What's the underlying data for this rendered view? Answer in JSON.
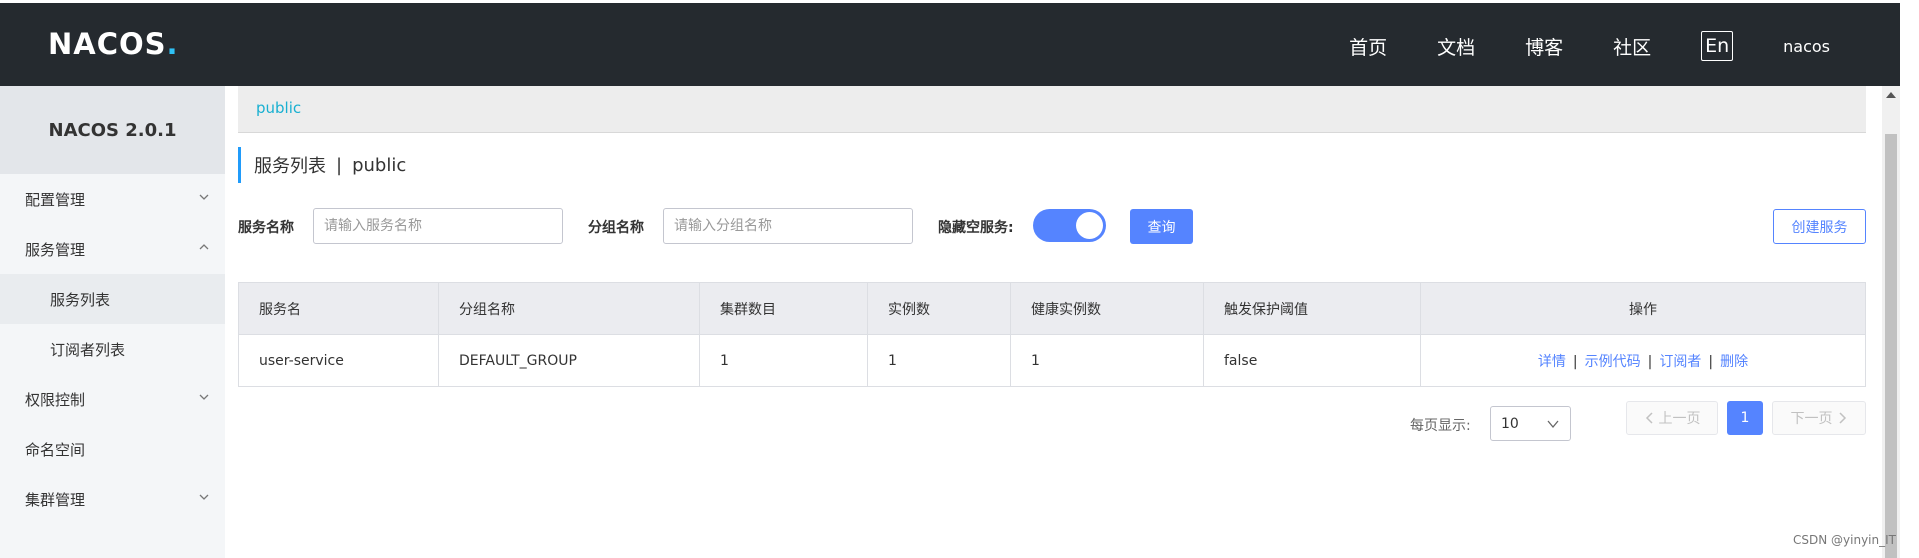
{
  "header": {
    "logo_text": "NACOS",
    "logo_dot": ".",
    "nav": [
      "首页",
      "文档",
      "博客",
      "社区"
    ],
    "lang": "En",
    "user": "nacos"
  },
  "sidebar": {
    "title": "NACOS 2.0.1",
    "items": [
      {
        "label": "配置管理"
      },
      {
        "label": "服务管理"
      },
      {
        "label": "服务列表"
      },
      {
        "label": "订阅者列表"
      },
      {
        "label": "权限控制"
      },
      {
        "label": "命名空间"
      },
      {
        "label": "集群管理"
      }
    ]
  },
  "breadcrumb": {
    "namespace": "public"
  },
  "page": {
    "title": "服务列表",
    "separator": "|",
    "namespace": "public"
  },
  "filters": {
    "service_name_label": "服务名称",
    "service_name_placeholder": "请输入服务名称",
    "group_name_label": "分组名称",
    "group_name_placeholder": "请输入分组名称",
    "hide_empty_label": "隐藏空服务:",
    "hide_empty_on": true,
    "query_label": "查询",
    "create_label": "创建服务"
  },
  "table": {
    "headers": [
      "服务名",
      "分组名称",
      "集群数目",
      "实例数",
      "健康实例数",
      "触发保护阈值",
      "操作"
    ],
    "rows": [
      [
        "user-service",
        "DEFAULT_GROUP",
        "1",
        "1",
        "1",
        "false"
      ]
    ],
    "actions": [
      "详情",
      "示例代码",
      "订阅者",
      "删除"
    ]
  },
  "pagination": {
    "per_page_label": "每页显示:",
    "per_page_value": "10",
    "prev_label": "上一页",
    "next_label": "下一页",
    "current_page": "1"
  },
  "watermark": "CSDN @yinyin_IT",
  "colors": {
    "header_bg": "#252a2f",
    "primary": "#5584ff",
    "link": "#19b0d1"
  }
}
